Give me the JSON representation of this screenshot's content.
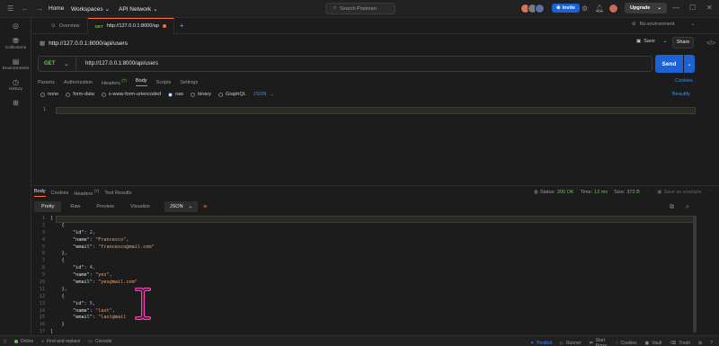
{
  "titlebar": {
    "nav_home": "Home",
    "nav_workspaces": "Workspaces",
    "nav_api": "API Network",
    "search_placeholder": "Search Postman",
    "invite": "Invite",
    "upgrade": "Upgrade"
  },
  "sidebar": {
    "items": [
      {
        "label": "Collections",
        "icon": "collections-icon"
      },
      {
        "label": "Environments",
        "icon": "environments-icon"
      },
      {
        "label": "History",
        "icon": "history-icon"
      },
      {
        "label": "",
        "icon": "apps-icon"
      }
    ]
  },
  "tabs": {
    "overview": "Overview",
    "active_method": "GET",
    "active_url": "http://127.0.0.1:8000/ap",
    "environment": "No environment"
  },
  "request": {
    "title": "http://127.0.0.1:8000/api/users",
    "method": "GET",
    "url": "http://127.0.0.1:8000/api/users",
    "save": "Save",
    "share": "Share",
    "send": "Send",
    "tabs": [
      {
        "label": "Params",
        "badge": ""
      },
      {
        "label": "Authorization",
        "badge": ""
      },
      {
        "label": "Headers",
        "badge": "(7)"
      },
      {
        "label": "Body",
        "badge": ""
      },
      {
        "label": "Scripts",
        "badge": ""
      },
      {
        "label": "Settings",
        "badge": ""
      }
    ],
    "cookies": "Cookies",
    "body_options": [
      "none",
      "form-data",
      "x-www-form-urlencoded",
      "raw",
      "binary",
      "GraphQL"
    ],
    "body_format": "JSON",
    "beautify": "Beautify",
    "editor_line_number": "1"
  },
  "response": {
    "tabs": [
      {
        "label": "Body",
        "badge": ""
      },
      {
        "label": "Cookies",
        "badge": ""
      },
      {
        "label": "Headers",
        "badge": "(7)"
      },
      {
        "label": "Test Results",
        "badge": ""
      }
    ],
    "status_label": "Status:",
    "status_value": "200 OK",
    "time_label": "Time:",
    "time_value": "12 ms",
    "size_label": "Size:",
    "size_value": "373 B",
    "save_example": "Save as example",
    "views": [
      "Pretty",
      "Raw",
      "Preview",
      "Visualize"
    ],
    "format": "JSON",
    "lines": [
      {
        "n": "1",
        "t": "["
      },
      {
        "n": "2",
        "t": "    {"
      },
      {
        "n": "3",
        "key": "\"id\"",
        "val": "2",
        "kind": "n",
        "indent": "        "
      },
      {
        "n": "4",
        "key": "\"name\"",
        "val": "\"Francesco\"",
        "kind": "s",
        "indent": "        "
      },
      {
        "n": "5",
        "key": "\"email\"",
        "val": "\"francesco@mail.com\"",
        "kind": "s",
        "indent": "        ",
        "last": true
      },
      {
        "n": "6",
        "t": "    },"
      },
      {
        "n": "7",
        "t": "    {"
      },
      {
        "n": "8",
        "key": "\"id\"",
        "val": "4",
        "kind": "n",
        "indent": "        "
      },
      {
        "n": "9",
        "key": "\"name\"",
        "val": "\"yes\"",
        "kind": "s",
        "indent": "        "
      },
      {
        "n": "10",
        "key": "\"email\"",
        "val": "\"yes@mail.com\"",
        "kind": "s",
        "indent": "        ",
        "last": true
      },
      {
        "n": "11",
        "t": "    },"
      },
      {
        "n": "12",
        "t": "    {"
      },
      {
        "n": "13",
        "key": "\"id\"",
        "val": "5",
        "kind": "n",
        "indent": "        "
      },
      {
        "n": "14",
        "key": "\"name\"",
        "val": "\"last\"",
        "kind": "s",
        "indent": "        "
      },
      {
        "n": "15",
        "key": "\"email\"",
        "val": "\"last@mail",
        "kind": "s",
        "indent": "        ",
        "last": true
      },
      {
        "n": "16",
        "t": "    }"
      },
      {
        "n": "17",
        "t": "]"
      }
    ]
  },
  "statusbar": {
    "online": "Online",
    "find": "Find and replace",
    "console": "Console",
    "postbot": "Postbot",
    "runner": "Runner",
    "proxy": "Start Proxy",
    "cookies": "Cookies",
    "vault": "Vault",
    "trash": "Trash"
  },
  "colors": {
    "accent": "#1d62d4",
    "get": "#6bbf59",
    "postman_orange": "#ff6c37"
  }
}
